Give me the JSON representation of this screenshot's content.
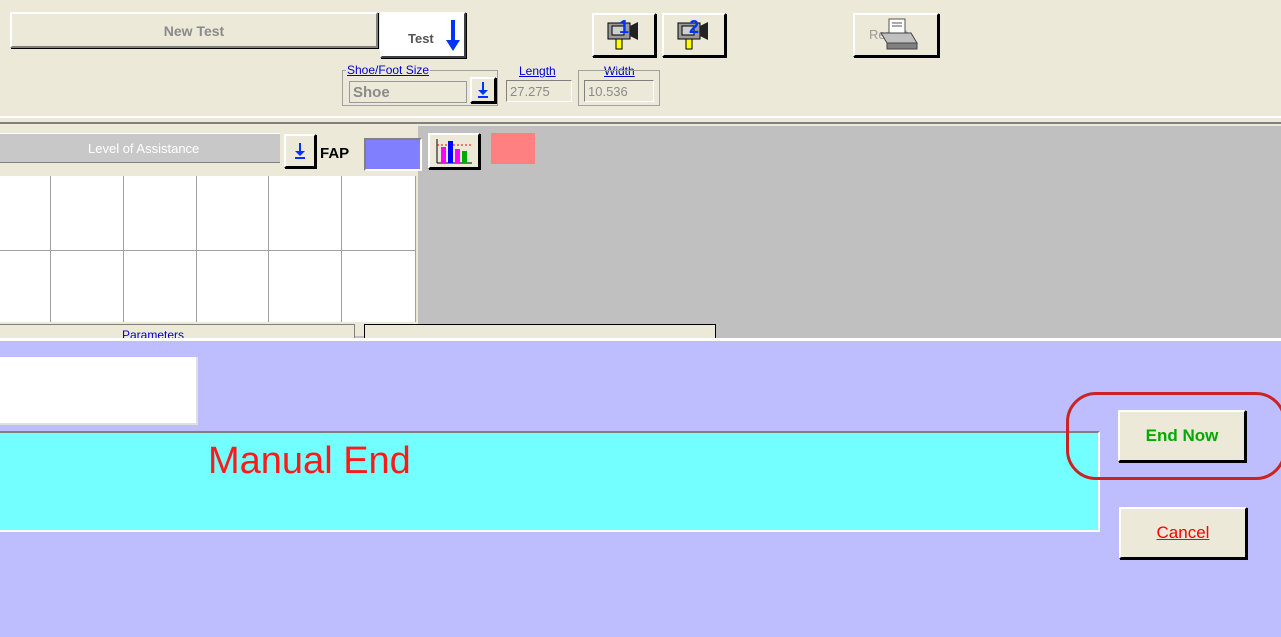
{
  "toolbar": {
    "new_test_label": "New Test",
    "test_label": "Test",
    "camera1_icon": "camera-1-icon",
    "camera2_icon": "camera-2-icon",
    "report_label": "Report"
  },
  "shoe_group": {
    "label": "Shoe/Foot Size",
    "value": "Shoe",
    "length_label": "Length",
    "length_value": "27.275",
    "width_label": "Width",
    "width_value": "10.536"
  },
  "assist": {
    "label": "Level of Assistance",
    "fap_label": "FAP",
    "fap_color": "#8080ff",
    "status_color": "#ff8080"
  },
  "params": {
    "label": "Parameters"
  },
  "dialog": {
    "status_text": "Manual End",
    "status_bg": "#73ffff",
    "status_color": "#ff1a1a",
    "end_now_label": "End Now",
    "cancel_label": "Cancel",
    "bg": "#bebeff"
  }
}
